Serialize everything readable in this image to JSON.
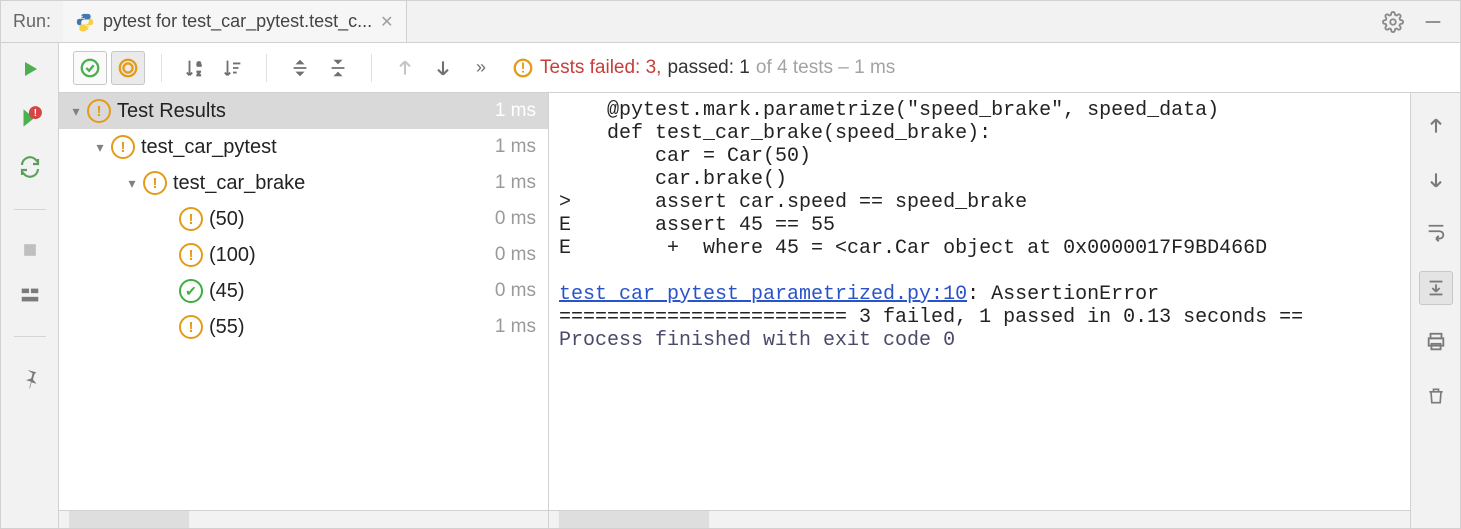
{
  "header": {
    "run_label": "Run:",
    "tab_title": "pytest for test_car_pytest.test_c..."
  },
  "summary": {
    "failed_label": "Tests failed:",
    "failed_count": "3,",
    "passed_label": "passed:",
    "passed_count": "1",
    "tail": "of 4 tests – 1 ms"
  },
  "tree": {
    "root": {
      "label": "Test Results",
      "time": "1 ms"
    },
    "file": {
      "label": "test_car_pytest",
      "time": "1 ms"
    },
    "func": {
      "label": "test_car_brake",
      "time": "1 ms"
    },
    "cases": [
      {
        "label": "(50)",
        "time": "0 ms",
        "status": "warn"
      },
      {
        "label": "(100)",
        "time": "0 ms",
        "status": "warn"
      },
      {
        "label": "(45)",
        "time": "0 ms",
        "status": "pass"
      },
      {
        "label": "(55)",
        "time": "1 ms",
        "status": "warn"
      }
    ]
  },
  "console": {
    "l1": "    @pytest.mark.parametrize(\"speed_brake\", speed_data)",
    "l2": "    def test_car_brake(speed_brake):",
    "l3": "        car = Car(50)",
    "l4": "        car.brake()",
    "l5": ">       assert car.speed == speed_brake",
    "l6": "E       assert 45 == 55",
    "l7": "E        +  where 45 = <car.Car object at 0x0000017F9BD466D",
    "link": "test_car_pytest_parametrized.py:10",
    "link_tail": ": AssertionError",
    "rule": "======================== 3 failed, 1 passed in 0.13 seconds ==",
    "exit": "Process finished with exit code 0"
  },
  "icons": {
    "python": "python-file-icon",
    "gear": "gear-icon",
    "minimize": "minimize-icon"
  }
}
